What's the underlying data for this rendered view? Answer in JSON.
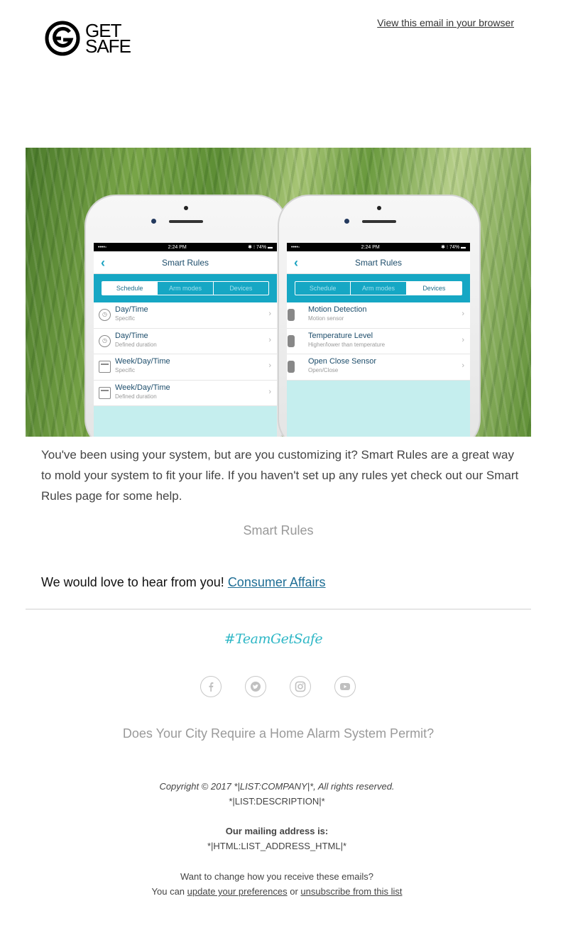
{
  "header": {
    "logo_line1": "GET",
    "logo_line2": "SAFE",
    "view_in_browser": "View this email in your browser"
  },
  "hero": {
    "left_phone": {
      "status_time": "2:24 PM",
      "status_carrier": "••••◦",
      "status_battery": "✱ ⁝ 74% ▬",
      "title": "Smart Rules",
      "tabs": [
        "Schedule",
        "Arm modes",
        "Devices"
      ],
      "active_tab": 0,
      "rows": [
        {
          "title": "Day/Time",
          "subtitle": "Specific",
          "icon": "clock-icon"
        },
        {
          "title": "Day/Time",
          "subtitle": "Defined duration",
          "icon": "clock-icon"
        },
        {
          "title": "Week/Day/Time",
          "subtitle": "Specific",
          "icon": "calendar-icon"
        },
        {
          "title": "Week/Day/Time",
          "subtitle": "Defined duration",
          "icon": "calendar-icon"
        }
      ]
    },
    "right_phone": {
      "status_time": "2:24 PM",
      "status_carrier": "••••◦",
      "status_battery": "✱ ⁝ 74% ▬",
      "title": "Smart Rules",
      "tabs": [
        "Schedule",
        "Arm modes",
        "Devices"
      ],
      "active_tab": 2,
      "rows": [
        {
          "title": "Motion Detection",
          "subtitle": "Motion sensor",
          "icon": "motion-sensor-icon"
        },
        {
          "title": "Temperature Level",
          "subtitle": "Higher/lower than temperature",
          "icon": "temperature-sensor-icon"
        },
        {
          "title": "Open Close Sensor",
          "subtitle": "Open/Close",
          "icon": "door-sensor-icon"
        }
      ]
    }
  },
  "body": {
    "intro": "You've been using your system, but are you customizing it? Smart Rules are a great way to mold your system to fit your life. If you haven't set up any rules yet check out our Smart Rules page for some help.",
    "smart_rules_link": "Smart Rules",
    "hear_text": "We would love to hear from you!",
    "consumer_affairs_link": "Consumer Affairs"
  },
  "footer": {
    "hashtag": "#TeamGetSafe",
    "social": [
      "facebook-icon",
      "twitter-icon",
      "instagram-icon",
      "youtube-icon"
    ],
    "permit_link": "Does Your City Require a Home Alarm System Permit?",
    "copyright": "Copyright © 2017 *|LIST:COMPANY|*, All rights reserved.",
    "description": "*|LIST:DESCRIPTION|*",
    "mailing_label": "Our mailing address is:",
    "mailing_address": "*|HTML:LIST_ADDRESS_HTML|*",
    "change_text": "Want to change how you receive these emails?",
    "you_can": "You can",
    "update_prefs": "update your preferences",
    "or": "or",
    "unsubscribe": "unsubscribe from this list"
  },
  "colors": {
    "accent_teal": "#16a7c4",
    "link_blue": "#1f6e95",
    "hashtag_teal": "#2fb7c6"
  }
}
